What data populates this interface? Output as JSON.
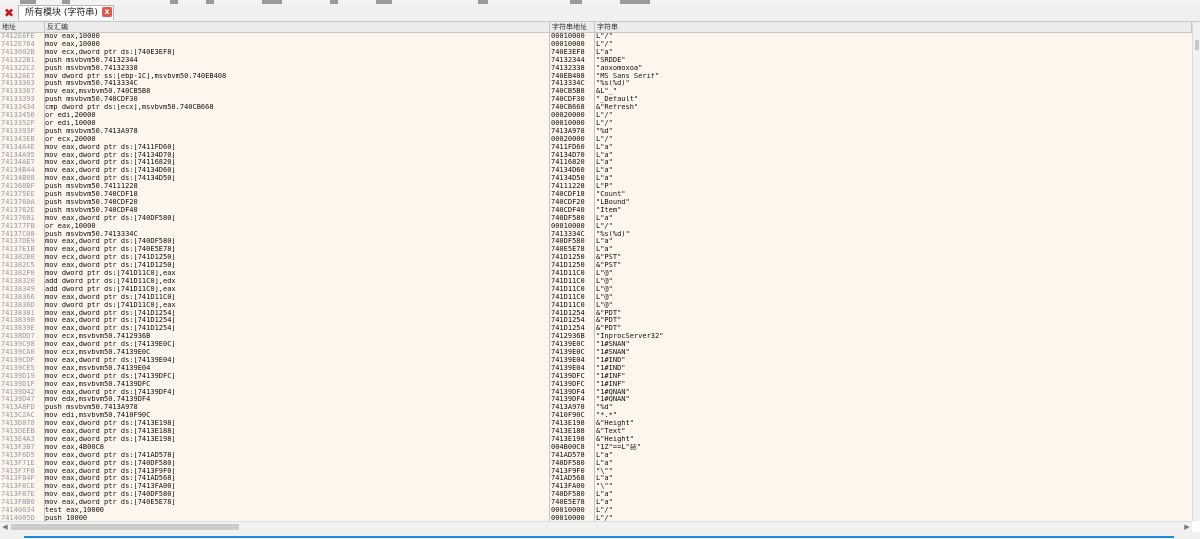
{
  "tab": {
    "title": "所有模块 (字符串)",
    "close": "x"
  },
  "columns": {
    "address": "地址",
    "disassembly": "反汇编",
    "string_address": "字符串地址",
    "string": "字符串"
  },
  "rows": [
    [
      "7412E6FE",
      "mov eax,10000",
      "00010000",
      "L\"/\""
    ],
    [
      "7412E764",
      "mov eax,10000",
      "00010000",
      "L\"/\""
    ],
    [
      "7413002B",
      "mov ecx,dword ptr ds:[740E3EF8]",
      "740E3EF8",
      "L\"a\""
    ],
    [
      "741322B1",
      "push msvbvm50.74132344",
      "74132344",
      "\"SRDDE\""
    ],
    [
      "741322C2",
      "push msvbvm50.74132338",
      "74132338",
      "\"aoxomoxoa\""
    ],
    [
      "74132AE7",
      "mov dword ptr ss:[ebp-1C],msvbvm50.740EB408",
      "740EB408",
      "\"MS Sans Serif\""
    ],
    [
      "74133303",
      "push msvbvm50.7413334C",
      "7413334C",
      "\"%s(%d)\""
    ],
    [
      "74133367",
      "mov eax,msvbvm50.740CB5B8",
      "740CB5B8",
      "&L\"_\""
    ],
    [
      "74133393",
      "push msvbvm50.740CDF30",
      "740CDF30",
      "\"_Default\""
    ],
    [
      "74133434",
      "cmp dword ptr ds:[ecx],msvbvm50.740CB668",
      "740CB668",
      "&\"Refresh\""
    ],
    [
      "74133450",
      "or edi,20000",
      "00020000",
      "L\"/\""
    ],
    [
      "7413352F",
      "or edi,10000",
      "00010000",
      "L\"/\""
    ],
    [
      "7413393F",
      "push msvbvm50.7413A978",
      "7413A978",
      "\"%d\""
    ],
    [
      "741343EB",
      "or ecx,20000",
      "00020000",
      "L\"/\""
    ],
    [
      "74134A4E",
      "mov eax,dword ptr ds:[7411FD60]",
      "7411FD60",
      "L\"a\""
    ],
    [
      "74134A95",
      "mov eax,dword ptr ds:[74134D70]",
      "74134D70",
      "L\"a\""
    ],
    [
      "74134AE7",
      "mov eax,dword ptr ds:[74116820]",
      "74116820",
      "L\"a\""
    ],
    [
      "74134B44",
      "mov eax,dword ptr ds:[74134D60]",
      "74134D60",
      "L\"a\""
    ],
    [
      "74134B88",
      "mov eax,dword ptr ds:[74134D50]",
      "74134D50",
      "L\"a\""
    ],
    [
      "741368BF",
      "push msvbvm50.74111228",
      "74111228",
      "L\"P\""
    ],
    [
      "741375EE",
      "push msvbvm50.740CDF18",
      "740CDF18",
      "\"Count\""
    ],
    [
      "7413760A",
      "push msvbvm50.740CDF20",
      "740CDF20",
      "\"LBound\""
    ],
    [
      "7413762E",
      "push msvbvm50.740CDF40",
      "740CDF40",
      "\"Item\""
    ],
    [
      "74137681",
      "mov eax,dword ptr ds:[740DF580]",
      "740DF580",
      "L\"a\""
    ],
    [
      "741377FB",
      "or eax,10000",
      "00010000",
      "L\"/\""
    ],
    [
      "74137C08",
      "push msvbvm50.7413334C",
      "7413334C",
      "\"%s(%d)\""
    ],
    [
      "74137DE9",
      "mov eax,dword ptr ds:[740DF580]",
      "740DF580",
      "L\"a\""
    ],
    [
      "74137E1B",
      "mov eax,dword ptr ds:[740E5E78]",
      "740E5E78",
      "L\"a\""
    ],
    [
      "741382B0",
      "mov ecx,dword ptr ds:[741D1250]",
      "741D1250",
      "&\"PST\""
    ],
    [
      "741382C5",
      "mov eax,dword ptr ds:[741D1250]",
      "741D1250",
      "&\"PST\""
    ],
    [
      "741382F0",
      "mov dword ptr ds:[741D11C0],eax",
      "741D11C0",
      "L\"@\""
    ],
    [
      "74138320",
      "add dword ptr ds:[741D11C0],edx",
      "741D11C0",
      "L\"@\""
    ],
    [
      "74138349",
      "add dword ptr ds:[741D11C0],eax",
      "741D11C0",
      "L\"@\""
    ],
    [
      "74138366",
      "mov eax,dword ptr ds:[741D11C0]",
      "741D11C0",
      "L\"@\""
    ],
    [
      "7413836D",
      "mov dword ptr ds:[741D11C0],eax",
      "741D11C0",
      "L\"@\""
    ],
    [
      "74138381",
      "mov eax,dword ptr ds:[741D1254]",
      "741D1254",
      "&\"PDT\""
    ],
    [
      "74138390",
      "mov eax,dword ptr ds:[741D1254]",
      "741D1254",
      "&\"PDT\""
    ],
    [
      "7413839E",
      "mov eax,dword ptr ds:[741D1254]",
      "741D1254",
      "&\"PDT\""
    ],
    [
      "74138DD7",
      "mov ecx,msvbvm50.7412936B",
      "7412936B",
      "\"InprocServer32\""
    ],
    [
      "74139C98",
      "mov eax,dword ptr ds:[74139E0C]",
      "74139E0C",
      "\"1#SNAN\""
    ],
    [
      "74139CA0",
      "mov ecx,msvbvm50.74139E0C",
      "74139E0C",
      "\"1#SNAN\""
    ],
    [
      "74139CDF",
      "mov eax,dword ptr ds:[74139E04]",
      "74139E04",
      "\"1#IND\""
    ],
    [
      "74139CE5",
      "mov eax,msvbvm50.74139E04",
      "74139E04",
      "\"1#IND\""
    ],
    [
      "74139D19",
      "mov ecx,dword ptr ds:[74139DFC]",
      "74139DFC",
      "\"1#INF\""
    ],
    [
      "74139D1F",
      "mov eax,msvbvm50.74139DFC",
      "74139DFC",
      "\"1#INF\""
    ],
    [
      "74139D42",
      "mov eax,dword ptr ds:[74139DF4]",
      "74139DF4",
      "\"1#QNAN\""
    ],
    [
      "74139D47",
      "mov edx,msvbvm50.74139DF4",
      "74139DF4",
      "\"1#QNAN\""
    ],
    [
      "7413A8FD",
      "push msvbvm50.7413A978",
      "7413A978",
      "\"%d\""
    ],
    [
      "7413C2AC",
      "mov edi,msvbvm50.7410F90C",
      "7410F90C",
      "\"*.*\""
    ],
    [
      "7413D878",
      "mov eax,dword ptr ds:[7413E198]",
      "7413E198",
      "&\"Height\""
    ],
    [
      "7413DEEB",
      "mov eax,dword ptr ds:[7413E188]",
      "7413E188",
      "&\"Text\""
    ],
    [
      "7413E4A3",
      "mov eax,dword ptr ds:[7413E198]",
      "7413E198",
      "&\"Height\""
    ],
    [
      "7413F3B7",
      "mov eax,4B00C8",
      "004B00C8",
      "\"1Z\"==L\"琵\""
    ],
    [
      "7413F6D5",
      "mov eax,dword ptr ds:[741AD578]",
      "741AD578",
      "L\"a\""
    ],
    [
      "7413F71E",
      "mov eax,dword ptr ds:[740DF580]",
      "740DF580",
      "L\"a\""
    ],
    [
      "7413F7F8",
      "mov eax,dword ptr ds:[7413F9F0]",
      "7413F9F0",
      "\"\\\"\""
    ],
    [
      "7413F84F",
      "mov eax,dword ptr ds:[741AD568]",
      "741AD568",
      "L\"a\""
    ],
    [
      "7413F8CE",
      "mov eax,dword ptr ds:[7413FA00]",
      "7413FA00",
      "\"\\\"\""
    ],
    [
      "7413F87E",
      "mov eax,dword ptr ds:[740DF580]",
      "740DF580",
      "L\"a\""
    ],
    [
      "7413FBB0",
      "mov eax,dword ptr ds:[740E5E78]",
      "740E5E78",
      "L\"a\""
    ],
    [
      "74140034",
      "test eax,10000",
      "00010000",
      "L\"/\""
    ],
    [
      "7414005D",
      "push 10000",
      "00010000",
      "L\"/\""
    ]
  ],
  "colors": {
    "grid_bg": "#fdf6ec",
    "address_fg": "#9a9aa6",
    "close_red": "#d11515",
    "status_blue": "#1c8ad8"
  }
}
